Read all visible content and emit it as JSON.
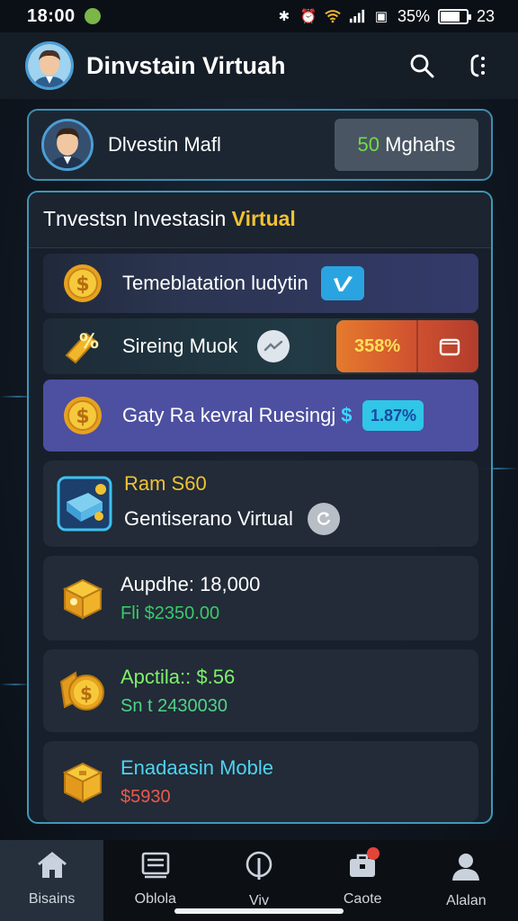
{
  "status_bar": {
    "time": "18:00",
    "battery": "35%",
    "extra": "23"
  },
  "app_bar": {
    "title": "Dinvstain Virtuah"
  },
  "profile": {
    "name": "Dlvestin Mafl",
    "badge_number": "50",
    "badge_text": "Mghahs"
  },
  "panel": {
    "header_prefix": "Tnvestsn Investasin ",
    "header_highlight": "Virtual",
    "rows": [
      {
        "label": "Temeblatation ludytin"
      },
      {
        "label": "Sireing Muok",
        "pill_value": "358%"
      },
      {
        "label": "Gaty Ra kevral Ruesingj",
        "symbol": "$",
        "pill_value": "1.87%"
      }
    ],
    "cards": [
      {
        "line_a": "Ram S60",
        "line_b": "Gentiserano Virtual"
      },
      {
        "line_a": "Aupdhe: 18,000",
        "line_b": "Fli $2350.00"
      },
      {
        "line_a": "Apctila:: $.56",
        "line_b": "Sn t 2430030"
      },
      {
        "line_a": "Enadaasin Moble",
        "line_b": "$5930"
      }
    ]
  },
  "bottom_nav": {
    "items": [
      {
        "label": "Bisains",
        "icon": "home-icon"
      },
      {
        "label": "Oblola",
        "icon": "list-icon"
      },
      {
        "label": "Viv",
        "icon": "location-icon"
      },
      {
        "label": "Caote",
        "icon": "briefcase-icon"
      },
      {
        "label": "Alalan",
        "icon": "person-icon"
      }
    ]
  },
  "colors": {
    "accent": "#3f98b8",
    "gold": "#f0c233",
    "purple_row": "#4d4fa0",
    "orange": "#e57a2c"
  }
}
